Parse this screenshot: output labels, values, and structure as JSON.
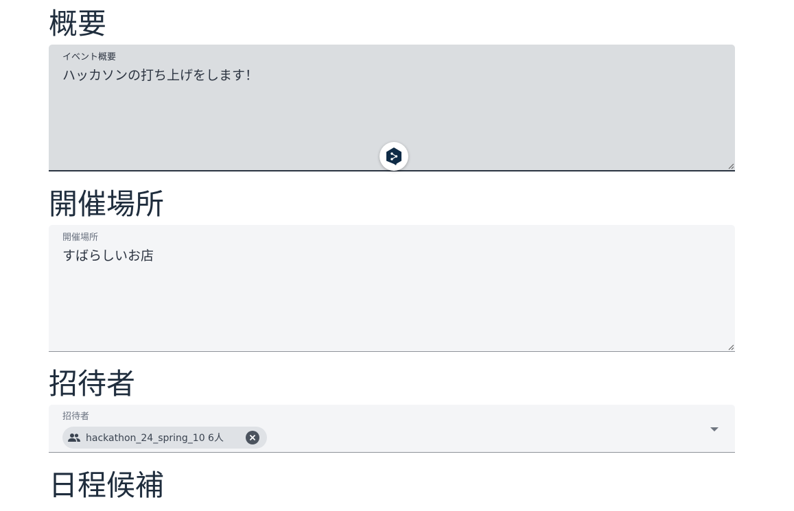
{
  "overview": {
    "heading": "概要",
    "field_label": "イベント概要",
    "field_value": "ハッカソンの打ち上げをします！"
  },
  "location": {
    "heading": "開催場所",
    "field_label": "開催場所",
    "field_value": "すばらしいお店"
  },
  "invitees": {
    "heading": "招待者",
    "field_label": "招待者",
    "chips": [
      {
        "label": "hackathon_24_spring_10 6人",
        "icon": "group-icon"
      }
    ]
  },
  "schedule": {
    "heading": "日程候補"
  },
  "assistant_icon": "deepl-translate-icon",
  "colors": {
    "heading": "#1f2d3d",
    "field_focused_bg": "#dadde0",
    "field_filled_bg": "#f4f5f7",
    "chip_bg": "#dfe2e6",
    "assistant_hex": "#0f2b46"
  }
}
